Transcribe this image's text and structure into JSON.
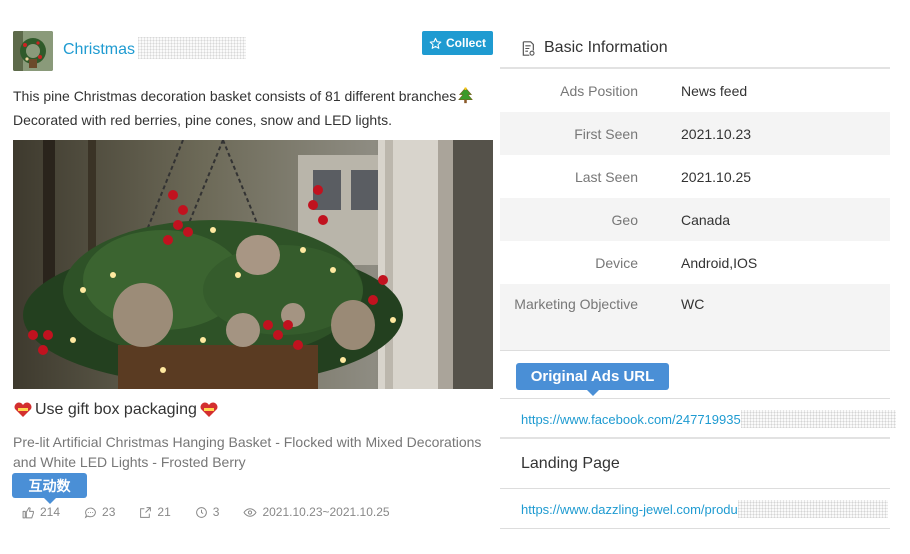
{
  "ad": {
    "title": "Christmas",
    "collect_label": "Collect",
    "description_lines": [
      "This pine Christmas decoration basket consists of 81 different branches",
      "Decorated with red berries, pine cones, snow and LED lights."
    ],
    "tagline": "Use gift box packaging",
    "subtitle": "Pre-lit Artificial Christmas Hanging Basket - Flocked with Mixed Decorations and White LED Lights - Frosted Berry",
    "interaction_label": "互动数",
    "stats": {
      "likes": "214",
      "comments": "23",
      "shares": "21",
      "time_count": "3",
      "date_range": "2021.10.23~2021.10.25"
    }
  },
  "basic_info": {
    "heading": "Basic Information",
    "rows": [
      {
        "label": "Ads Position",
        "value": "News feed"
      },
      {
        "label": "First Seen",
        "value": "2021.10.23"
      },
      {
        "label": "Last Seen",
        "value": "2021.10.25"
      },
      {
        "label": "Geo",
        "value": "Canada"
      },
      {
        "label": "Device",
        "value": "Android,IOS"
      },
      {
        "label": "Marketing Objective",
        "value": "WC"
      }
    ]
  },
  "original_ads": {
    "label": "Original Ads URL",
    "url": "https://www.facebook.com/247719935"
  },
  "landing": {
    "label": "Landing Page",
    "url": "https://www.dazzling-jewel.com/produ"
  },
  "colors": {
    "accent": "#1f9bd1",
    "bubble": "#4a8fd6",
    "row_alt": "#f4f4f4"
  }
}
